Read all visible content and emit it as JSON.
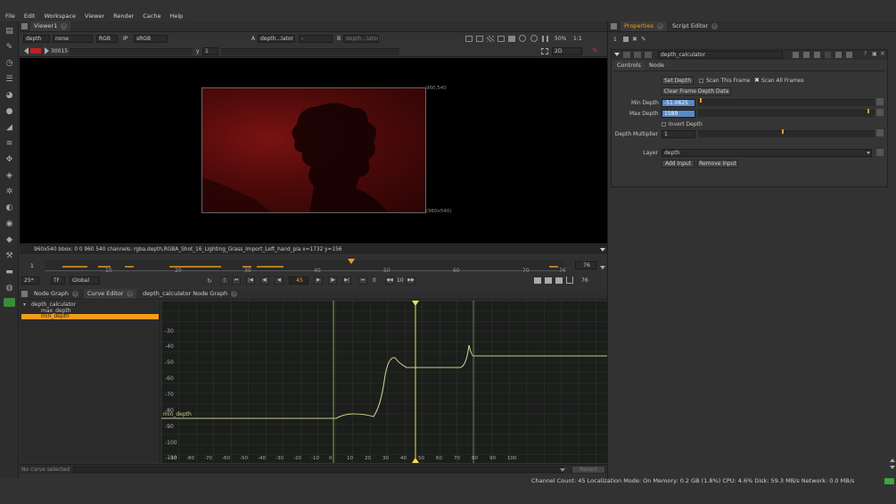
{
  "menu": [
    "File",
    "Edit",
    "Workspace",
    "Viewer",
    "Render",
    "Cache",
    "Help"
  ],
  "viewer": {
    "tab": "Viewer1",
    "channels_sel": "depth",
    "second_sel": "none",
    "rgb_sel": "RGB",
    "ip": "IP",
    "colorspace": "sRGB",
    "a_label": "A",
    "a_input": "depth...lator",
    "dash": "-",
    "b_label": "B",
    "b_input": "depth...lator",
    "zoom": "50%",
    "ratio": "1:1",
    "frame": "30015",
    "y_label": "y",
    "y_value": "1",
    "view_mode": "2D",
    "corner_tr": "960,540",
    "corner_br": "(960x540)",
    "info": "960x540  bbox: 0 0 960 540 channels: rgba,depth,RGBA_Shot_16_Lighting_Grass_Import_Left_hand_pla  x=1732 y=156"
  },
  "timeline": {
    "start": "1",
    "end": "76",
    "ticks": [
      "10",
      "20",
      "30",
      "40",
      "50",
      "60",
      "70",
      "76"
    ],
    "current": "45",
    "fps": "25*",
    "tf": "TF",
    "scope": "Global",
    "inc": "10",
    "play_end": "76",
    "zero": "0"
  },
  "curve": {
    "tabs": [
      "Node Graph",
      "Curve Editor",
      "depth_calculator Node Graph"
    ],
    "tree": [
      "depth_calculator",
      "max_depth",
      "min_depth"
    ],
    "curve_label": "min_depth",
    "y_labels": [
      "-30",
      "-40",
      "-50",
      "-60",
      "-70",
      "-80",
      "-90",
      "-100",
      "-110"
    ],
    "x_labels": [
      "-90",
      "-80",
      "-70",
      "-60",
      "-50",
      "-40",
      "-30",
      "-20",
      "-10",
      "0",
      "10",
      "20",
      "30",
      "40",
      "50",
      "60",
      "70",
      "80",
      "90",
      "100"
    ],
    "status": "No curve selected",
    "revert": "Revert"
  },
  "properties": {
    "tabs": [
      "Properties",
      "Script Editor"
    ],
    "count": "1",
    "node": "depth_calculator",
    "subtabs": [
      "Controls",
      "Node"
    ],
    "set_depth": "Set Depth",
    "scan_this": "Scan This Frame",
    "scan_all": "Scan All Frames",
    "clear": "Clear Frame Depth Data",
    "min_label": "Min Depth",
    "min_value": "-51.0625",
    "max_label": "Max Depth",
    "max_value": "1589",
    "invert": "Invert Depth",
    "mult_label": "Depth Multiplier",
    "mult_value": "1",
    "layer_label": "Layer",
    "layer_value": "depth",
    "add": "Add Input",
    "remove": "Remove Input"
  },
  "status_bar": "Channel Count: 45  Localization Mode: On  Memory: 0.2 GB (1.8%)  CPU: 4.6%  Disk: 59.3 MB/s  Network: 0.0 MB/s",
  "colors": {
    "accent": "#f39c1a",
    "selection": "#5a8ac6",
    "curve": "#c9c98a",
    "grid": "#3a5a3a"
  }
}
